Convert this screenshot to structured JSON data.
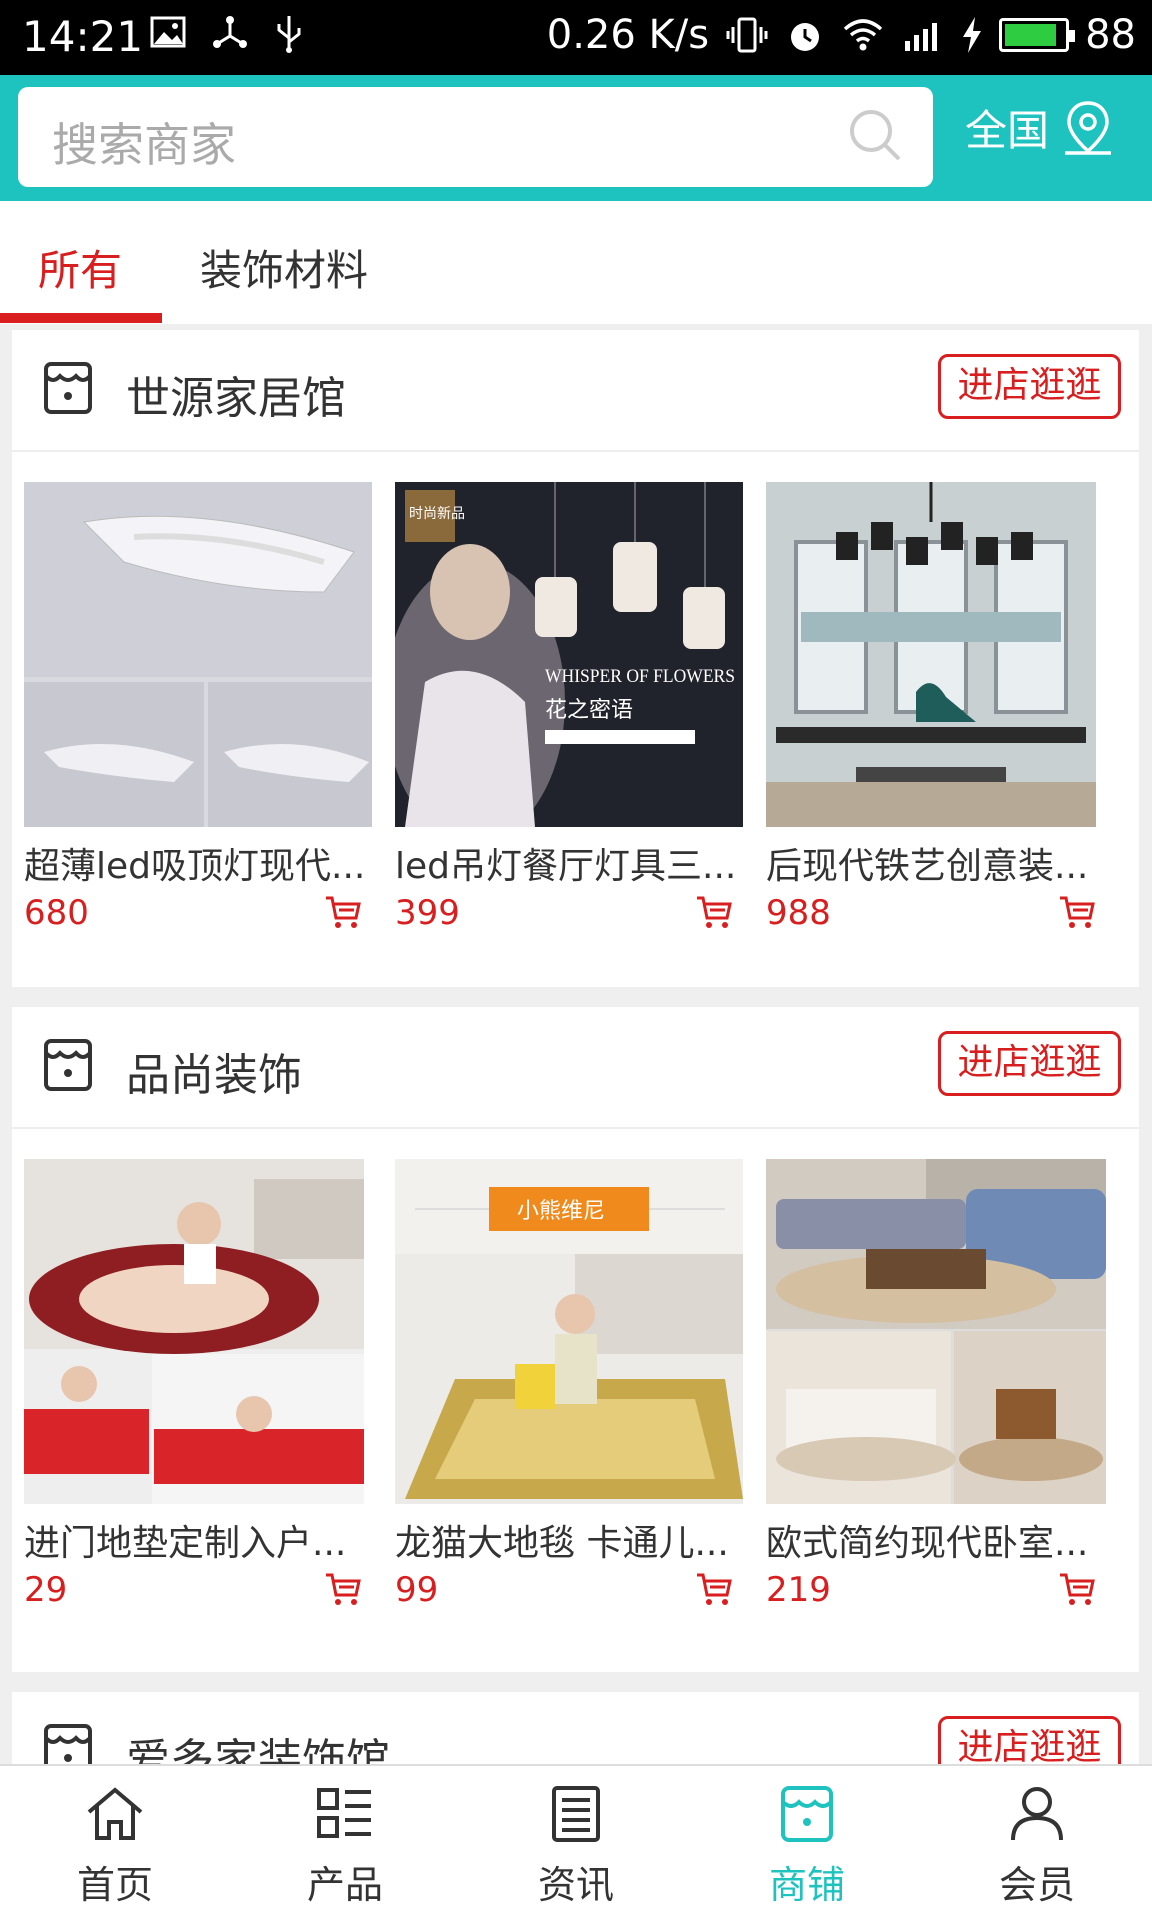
{
  "status_bar": {
    "time": "14:21",
    "net_speed": "0.26 K/s",
    "network": "4G",
    "battery": "88",
    "battery_level": 0.88
  },
  "search": {
    "placeholder": "搜索商家"
  },
  "region": {
    "label": "全国"
  },
  "tabs": [
    {
      "label": "所有",
      "active": true
    },
    {
      "label": "装饰材料",
      "active": false
    }
  ],
  "stores": [
    {
      "name": "世源家居馆",
      "enter_label": "进店逛逛",
      "products": [
        {
          "name": "超薄led吸顶灯现代...",
          "price": "680"
        },
        {
          "name": "led吊灯餐厅灯具三...",
          "price": "399"
        },
        {
          "name": "后现代铁艺创意装...",
          "price": "988"
        }
      ]
    },
    {
      "name": "品尚装饰",
      "enter_label": "进店逛逛",
      "products": [
        {
          "name": "进门地垫定制入户...",
          "price": "29"
        },
        {
          "name": "龙猫大地毯 卡通儿...",
          "price": "99"
        },
        {
          "name": "欧式简约现代卧室...",
          "price": "219"
        }
      ]
    },
    {
      "name": "爱多家装饰馆",
      "enter_label": "进店逛逛"
    }
  ],
  "product_image_text": {
    "lamp2_badge": "时尚新品",
    "lamp2_title": "WHISPER OF FLOWERS",
    "lamp2_sub": "花之密语",
    "rug2_banner": "小熊维尼"
  },
  "bottom_nav": [
    {
      "label": "首页",
      "icon": "home-icon",
      "active": false
    },
    {
      "label": "产品",
      "icon": "products-icon",
      "active": false
    },
    {
      "label": "资讯",
      "icon": "news-icon",
      "active": false
    },
    {
      "label": "商铺",
      "icon": "store-icon",
      "active": true
    },
    {
      "label": "会员",
      "icon": "member-icon",
      "active": false
    }
  ],
  "colors": {
    "accent": "#1ec3c0",
    "primary_red": "#d81e1e"
  }
}
